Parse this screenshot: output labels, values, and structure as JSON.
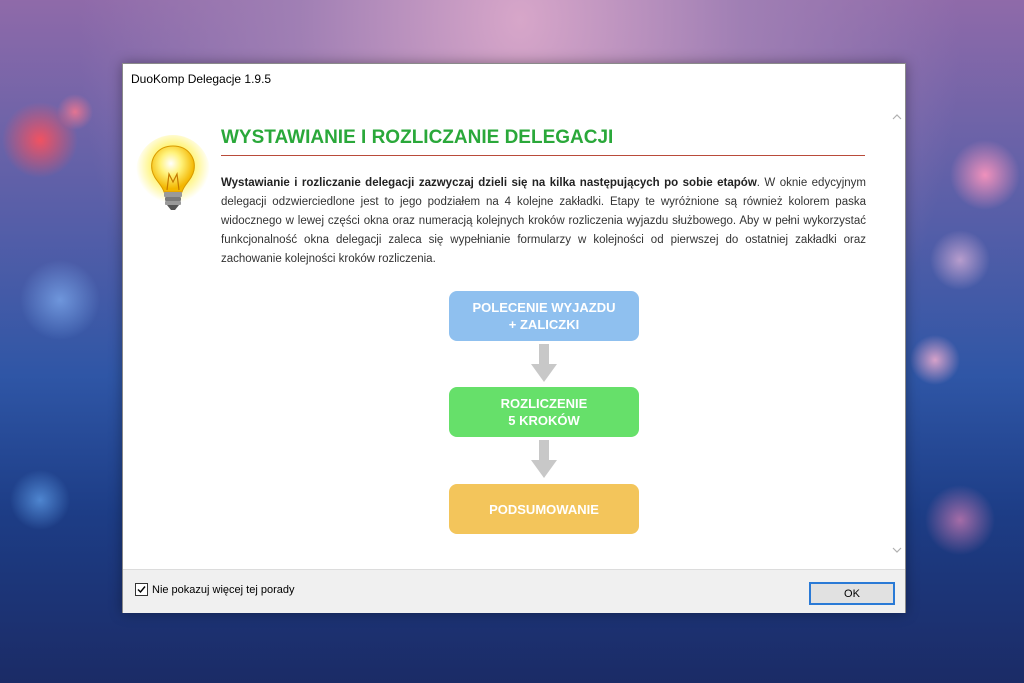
{
  "window": {
    "title": "DuoKomp Delegacje 1.9.5"
  },
  "content": {
    "heading": "WYSTAWIANIE I ROZLICZANIE DELEGACJI",
    "paragraph_bold": "Wystawianie i rozliczanie delegacji zazwyczaj dzieli się na kilka następujących po sobie etapów",
    "paragraph_rest": ". W oknie edycyjnym delegacji odzwierciedlone jest to jego podziałem na 4 kolejne zakładki. Etapy te wyróżnione są również kolorem paska widocznego w lewej części okna oraz numeracją kolejnych kroków rozliczenia wyjazdu służbowego. Aby w pełni wykorzystać funkcjonalność okna delegacji zaleca się wypełnianie formularzy w kolejności od pierwszej do ostatniej zakładki oraz zachowanie kolejności kroków rozliczenia.",
    "flow": {
      "step1_line1": "POLECENIE WYJAZDU",
      "step1_line2": "+ ZALICZKI",
      "step2_line1": "ROZLICZENIE",
      "step2_line2": "5 KROKÓW",
      "step3": "PODSUMOWANIE"
    },
    "colors": {
      "heading": "#2aa83a",
      "step1": "#8fc0ef",
      "step2": "#66e06a",
      "step3": "#f3c55b"
    }
  },
  "footer": {
    "checkbox_label": "Nie pokazuj więcej tej porady",
    "checkbox_checked": true,
    "ok_label": "OK"
  },
  "icons": [
    "lightbulb-icon",
    "arrow-down-icon",
    "scroll-up-icon",
    "scroll-down-icon",
    "checkmark-icon"
  ]
}
